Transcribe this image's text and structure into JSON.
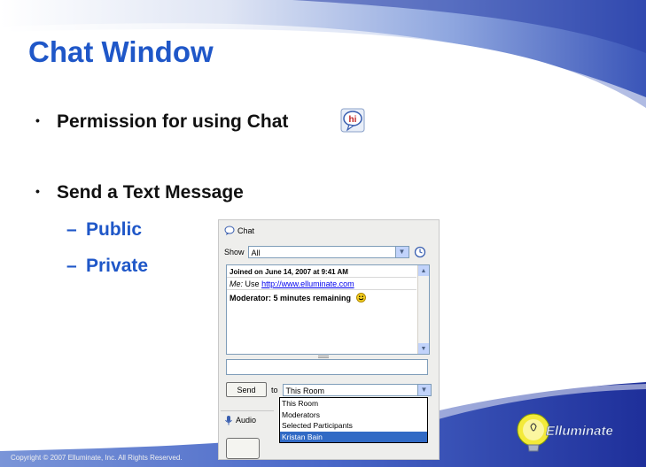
{
  "slide": {
    "title": "Chat Window",
    "bullets": [
      {
        "text": "Permission for using Chat"
      },
      {
        "text": "Send a Text Message"
      }
    ],
    "sub_bullets": [
      {
        "dash": "–",
        "text": "Public"
      },
      {
        "dash": "–",
        "text": "Private"
      }
    ],
    "footer": "Copyright © 2007 Elluminate, Inc. All Rights Reserved.",
    "logo_text": "Elluminate",
    "permission_icon_text": "hi"
  },
  "chat_panel": {
    "title": "Chat",
    "show_label": "Show",
    "show_value": "All",
    "messages": {
      "joined": "Joined on June 14, 2007 at 9:41 AM",
      "me_label": "Me:",
      "me_text": "Use",
      "me_link": "http://www.elluminate.com",
      "moderator": "Moderator: 5 minutes remaining"
    },
    "send_label": "Send",
    "to_label": "to",
    "to_value": "This Room",
    "recipient_options": [
      "This Room",
      "Moderators",
      "Selected Participants",
      "Kristan Bain"
    ],
    "selected_option_index": 3,
    "audio_title": "Audio"
  },
  "colors": {
    "title_blue": "#1f57c8",
    "swoosh_dark": "#1e2f9a",
    "swoosh_light": "#6f8fd6",
    "selection": "#316ac5"
  }
}
